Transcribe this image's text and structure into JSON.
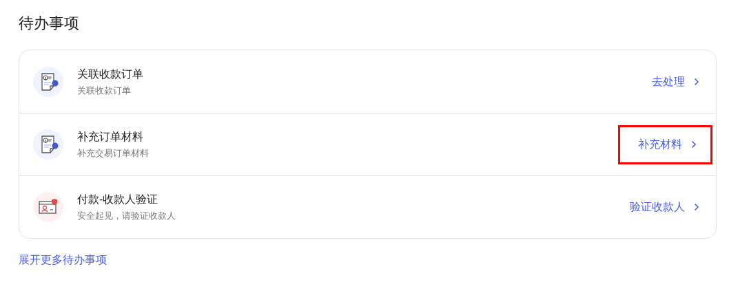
{
  "title": "待办事项",
  "items": [
    {
      "kind": "order",
      "title": "关联收款订单",
      "subtitle": "关联收款订单",
      "action": "去处理",
      "highlighted": false
    },
    {
      "kind": "order",
      "title": "补充订单材料",
      "subtitle": "补充交易订单材料",
      "action": "补充材料",
      "highlighted": true
    },
    {
      "kind": "payee",
      "title": "付款-收款人验证",
      "subtitle": "安全起见，请验证收款人",
      "action": "验证收款人",
      "highlighted": false
    }
  ],
  "more_link": "展开更多待办事项"
}
